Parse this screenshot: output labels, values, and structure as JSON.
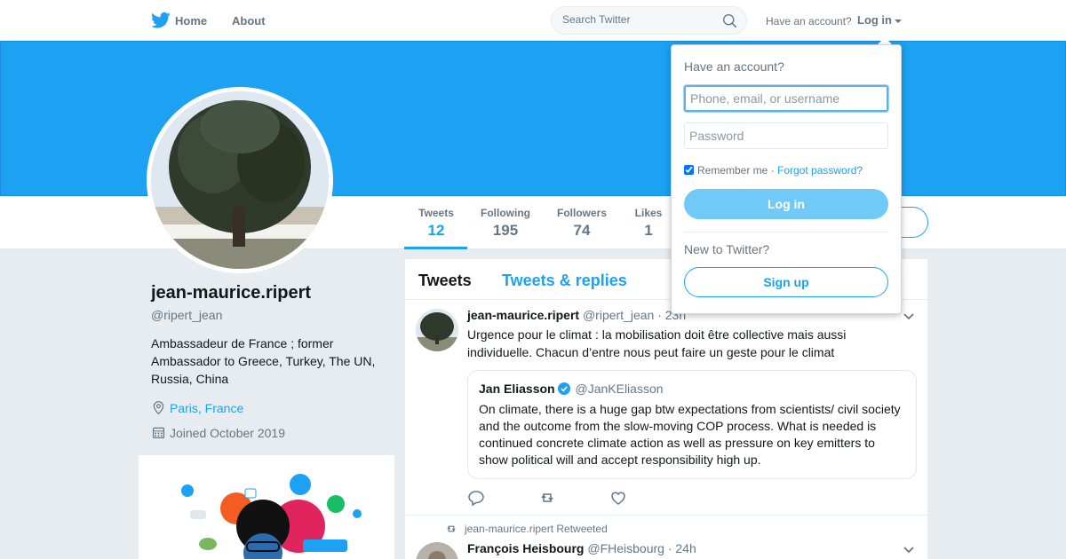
{
  "nav": {
    "logo_icon": "twitter-bird-icon",
    "home_label": "Home",
    "about_label": "About",
    "search_placeholder": "Search Twitter",
    "search_icon": "search-icon",
    "have_account": "Have an account?",
    "login_label": "Log in"
  },
  "colors": {
    "accent": "#1da1f2",
    "banner": "#1da1f2",
    "background": "#e6ecf0"
  },
  "stats": [
    {
      "label": "Tweets",
      "value": "12"
    },
    {
      "label": "Following",
      "value": "195"
    },
    {
      "label": "Followers",
      "value": "74"
    },
    {
      "label": "Likes",
      "value": "1"
    }
  ],
  "profile": {
    "name": "jean-maurice.ripert",
    "handle": "@ripert_jean",
    "bio": "Ambassadeur de France ; former Ambassador to Greece, Turkey, The UN, Russia, China",
    "location": "Paris, France",
    "joined": "Joined October 2019"
  },
  "timeline": {
    "tabs": [
      "Tweets",
      "Tweets & replies"
    ],
    "tweets": [
      {
        "name": "jean-maurice.ripert",
        "handle": "@ripert_jean",
        "time": "· 23h",
        "text": "Urgence pour le climat : la mobilisation doit être collective mais aussi individuelle. Chacun d’entre nous peut faire un geste pour le climat",
        "quote": {
          "name": "Jan Eliasson",
          "handle": "@JanKEliasson",
          "text": "On climate, there is a huge gap btw expectations from scientists/ civil society and the outcome from the slow-moving COP process. What is needed is continued concrete climate action as well as pressure on key emitters  to show political will and accept responsibility high up."
        }
      },
      {
        "retweet_context": "jean-maurice.ripert Retweeted",
        "name": "François Heisbourg",
        "handle": "@FHeisbourg",
        "time": "· 24h"
      }
    ]
  },
  "login_dropdown": {
    "title": "Have an account?",
    "username_placeholder": "Phone, email, or username",
    "password_placeholder": "Password",
    "remember_label": "Remember me",
    "separator": " · ",
    "forgot_label": "Forgot password?",
    "login_button": "Log in",
    "new_label": "New to Twitter?",
    "signup_button": "Sign up"
  }
}
